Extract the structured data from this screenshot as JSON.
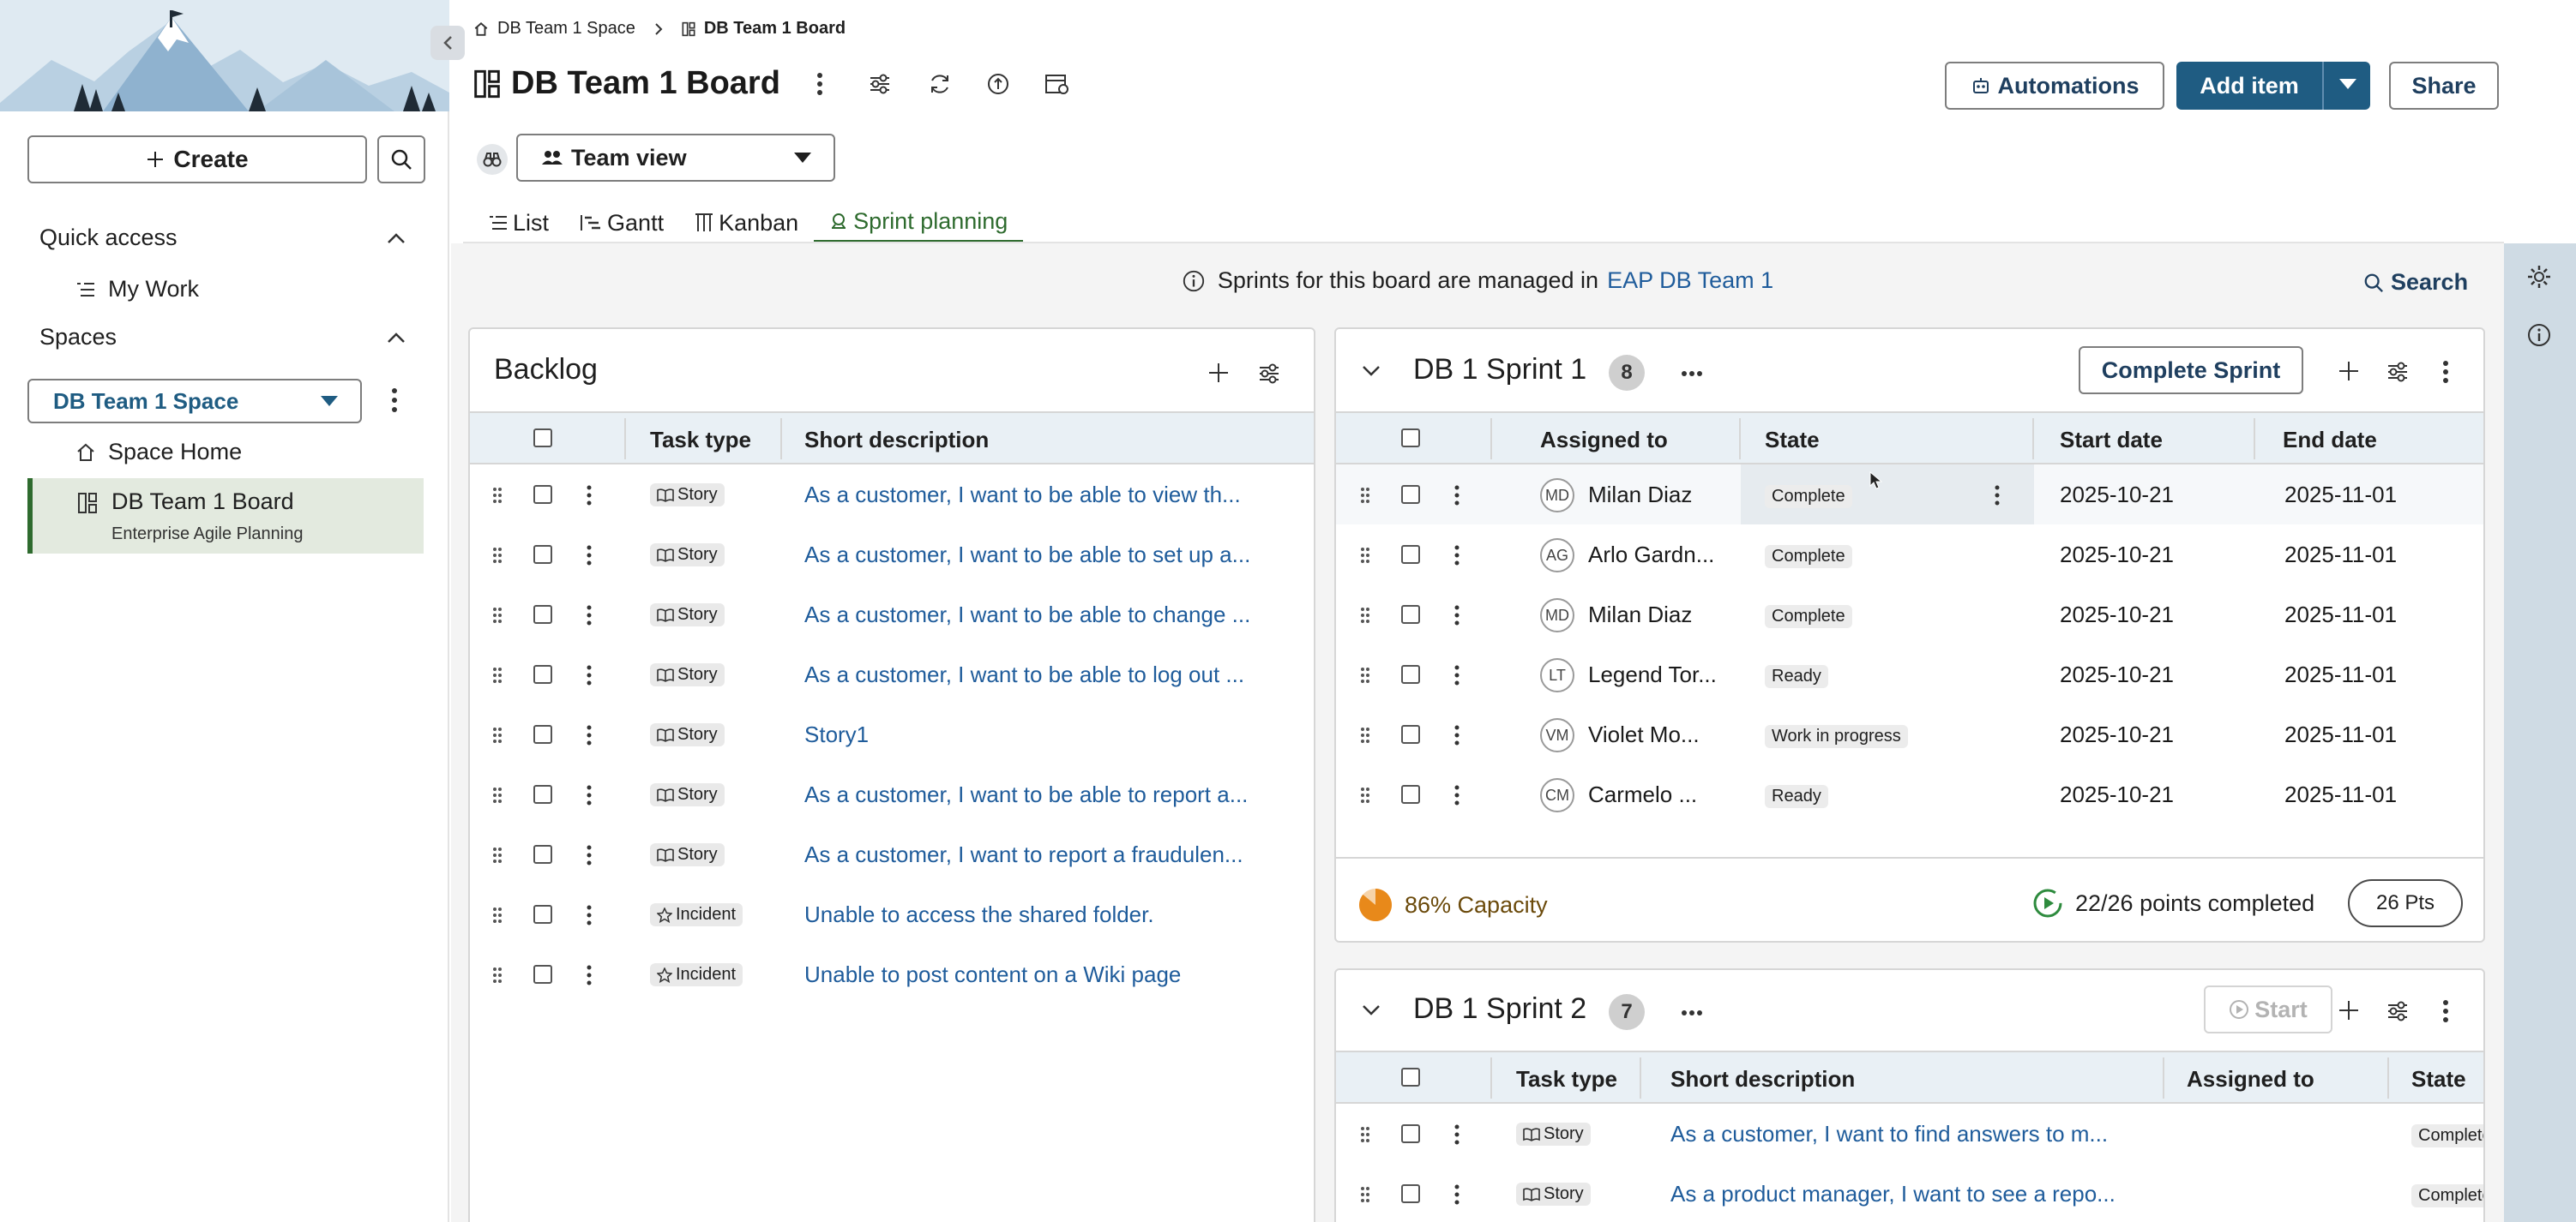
{
  "sidebar": {
    "create_label": "Create",
    "quick_access_label": "Quick access",
    "my_work_label": "My Work",
    "spaces_label": "Spaces",
    "space_select_value": "DB Team 1 Space",
    "space_home_label": "Space Home",
    "board_item_label": "DB Team 1 Board",
    "board_item_sublabel": "Enterprise Agile Planning"
  },
  "breadcrumb": {
    "space": "DB Team 1 Space",
    "board": "DB Team 1 Board"
  },
  "header": {
    "title": "DB Team 1 Board",
    "automations_label": "Automations",
    "add_item_label": "Add item",
    "share_label": "Share",
    "view_select_value": "Team view"
  },
  "tabs": [
    "List",
    "Gantt",
    "Kanban",
    "Sprint planning"
  ],
  "banner": {
    "text": "Sprints for this board are managed in",
    "link": "EAP DB Team 1",
    "search_label": "Search"
  },
  "backlog": {
    "title": "Backlog",
    "columns": [
      "Task type",
      "Short description"
    ],
    "rows": [
      {
        "type": "Story",
        "desc": "As a customer, I want to be able to view th..."
      },
      {
        "type": "Story",
        "desc": "As a customer, I want to be able to set up a..."
      },
      {
        "type": "Story",
        "desc": "As a customer, I want to be able to change ..."
      },
      {
        "type": "Story",
        "desc": "As a customer, I want to be able to log out ..."
      },
      {
        "type": "Story",
        "desc": "Story1"
      },
      {
        "type": "Story",
        "desc": "As a customer, I want to be able to report a..."
      },
      {
        "type": "Story",
        "desc": "As a customer, I want to report a fraudulen..."
      },
      {
        "type": "Incident",
        "desc": "Unable to access the shared folder."
      },
      {
        "type": "Incident",
        "desc": "Unable to post content on a Wiki page"
      }
    ]
  },
  "sprint1": {
    "title": "DB 1 Sprint 1",
    "count": "8",
    "complete_label": "Complete Sprint",
    "columns": [
      "Assigned to",
      "State",
      "Start date",
      "End date"
    ],
    "rows": [
      {
        "initials": "MD",
        "name": "Milan Diaz",
        "state": "Complete",
        "start": "2025-10-21",
        "end": "2025-11-01"
      },
      {
        "initials": "AG",
        "name": "Arlo Gardn...",
        "state": "Complete",
        "start": "2025-10-21",
        "end": "2025-11-01"
      },
      {
        "initials": "MD",
        "name": "Milan Diaz",
        "state": "Complete",
        "start": "2025-10-21",
        "end": "2025-11-01"
      },
      {
        "initials": "LT",
        "name": "Legend Tor...",
        "state": "Ready",
        "start": "2025-10-21",
        "end": "2025-11-01"
      },
      {
        "initials": "VM",
        "name": "Violet Mo...",
        "state": "Work in progress",
        "start": "2025-10-21",
        "end": "2025-11-01"
      },
      {
        "initials": "CM",
        "name": "Carmelo ...",
        "state": "Ready",
        "start": "2025-10-21",
        "end": "2025-11-01"
      }
    ],
    "capacity_label": "86% Capacity",
    "capacity_value": 0.86,
    "points_label": "22/26 points completed",
    "pts_pill": "26 Pts"
  },
  "sprint2": {
    "title": "DB 1 Sprint 2",
    "count": "7",
    "start_label": "Start",
    "columns": [
      "Task type",
      "Short description",
      "Assigned to",
      "State"
    ],
    "rows": [
      {
        "type": "Story",
        "desc": "As a customer, I want to find answers to m...",
        "state": "Complete"
      },
      {
        "type": "Story",
        "desc": "As a product manager, I want to see a repo...",
        "state": "Complete"
      }
    ]
  },
  "colors": {
    "brand_blue": "#1f5c82",
    "link_blue": "#1f5c9b",
    "active_green": "#2e6b2e",
    "capacity_orange": "#e8891a"
  }
}
